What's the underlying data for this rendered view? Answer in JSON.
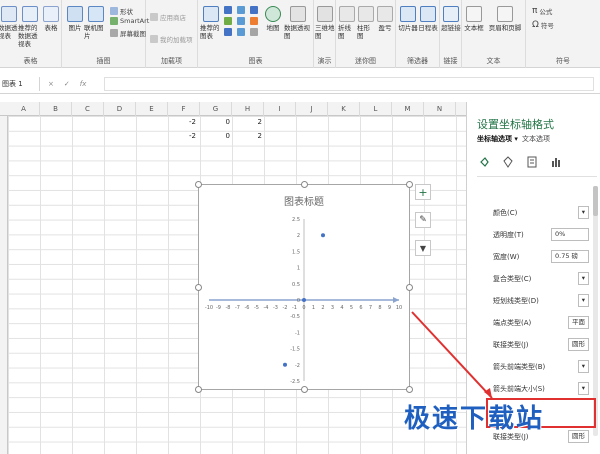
{
  "ribbon": {
    "groups": [
      {
        "title": "表格",
        "buttons": [
          "数据透视表",
          "推荐的数据透视表",
          "表格"
        ]
      },
      {
        "title": "插图",
        "buttons": [
          "图片",
          "联机图片",
          "形状",
          "SmartArt",
          "屏幕截图"
        ]
      },
      {
        "title": "加载项",
        "buttons": [
          "应用商店",
          "我的加载项"
        ]
      },
      {
        "title": "图表",
        "buttons": [
          "推荐的图表",
          "地图",
          "数据透视图"
        ]
      },
      {
        "title": "演示",
        "buttons": [
          "三维地图"
        ]
      },
      {
        "title": "迷你图",
        "buttons": [
          "折线图",
          "柱形图",
          "盈亏"
        ]
      },
      {
        "title": "筛选器",
        "buttons": [
          "切片器",
          "日程表"
        ]
      },
      {
        "title": "链接",
        "buttons": [
          "超链接"
        ]
      },
      {
        "title": "文本",
        "buttons": [
          "文本框",
          "页眉和页脚"
        ]
      },
      {
        "title": "符号",
        "buttons": [
          "公式",
          "符号"
        ]
      }
    ]
  },
  "formula_bar": {
    "name_box": "图表 1",
    "cancel": "×",
    "enter": "✓",
    "fx": "fx"
  },
  "columns": [
    "A",
    "B",
    "C",
    "D",
    "E",
    "F",
    "G",
    "H",
    "I",
    "J",
    "K",
    "L",
    "M",
    "N"
  ],
  "cells": [
    {
      "row": 0,
      "values": [
        "-2",
        "0",
        "2"
      ]
    },
    {
      "row": 1,
      "values": [
        "-2",
        "0",
        "2"
      ]
    }
  ],
  "chart_data": {
    "type": "scatter",
    "title": "图表标题",
    "xlim": [
      -10,
      10
    ],
    "ylim": [
      -2.5,
      2.5
    ],
    "xticks": [
      -10,
      -9,
      -8,
      -7,
      -6,
      -5,
      -4,
      -3,
      -2,
      -1,
      0,
      1,
      2,
      3,
      4,
      5,
      6,
      7,
      8,
      9,
      10
    ],
    "yticks": [
      2.5,
      2,
      1.5,
      1,
      0.5,
      0,
      -0.5,
      -1,
      -1.5,
      -2,
      -2.5
    ],
    "points": [
      {
        "x": -2,
        "y": -2
      },
      {
        "x": 0,
        "y": 0
      },
      {
        "x": 2,
        "y": 2
      }
    ],
    "color": "#4472c4"
  },
  "chart_tools": [
    "+",
    "✎",
    "▼"
  ],
  "pane": {
    "title": "设置坐标轴格式",
    "tab_active": "坐标轴选项 ▾",
    "tab_other": "文本选项",
    "properties": [
      {
        "label": "颜色(C)",
        "value": "▾"
      },
      {
        "label": "透明度(T)",
        "value": "0%"
      },
      {
        "label": "宽度(W)",
        "value": "0.75 磅"
      },
      {
        "label": "复合类型(C)",
        "value": "▾"
      },
      {
        "label": "短划线类型(D)",
        "value": "▾"
      },
      {
        "label": "端点类型(A)",
        "value": "平面"
      },
      {
        "label": "联接类型(J)",
        "value": "圆形"
      },
      {
        "label": "箭头前端类型(B)",
        "value": "▾"
      },
      {
        "label": "箭头前端大小(S)",
        "value": "▾"
      },
      {
        "label": "联接类型(J)",
        "value": "圆形"
      }
    ]
  },
  "watermark": "极速下载站",
  "colors": {
    "accent": "#217346",
    "highlight": "#e03030",
    "watermark": "#1f5fbf"
  }
}
